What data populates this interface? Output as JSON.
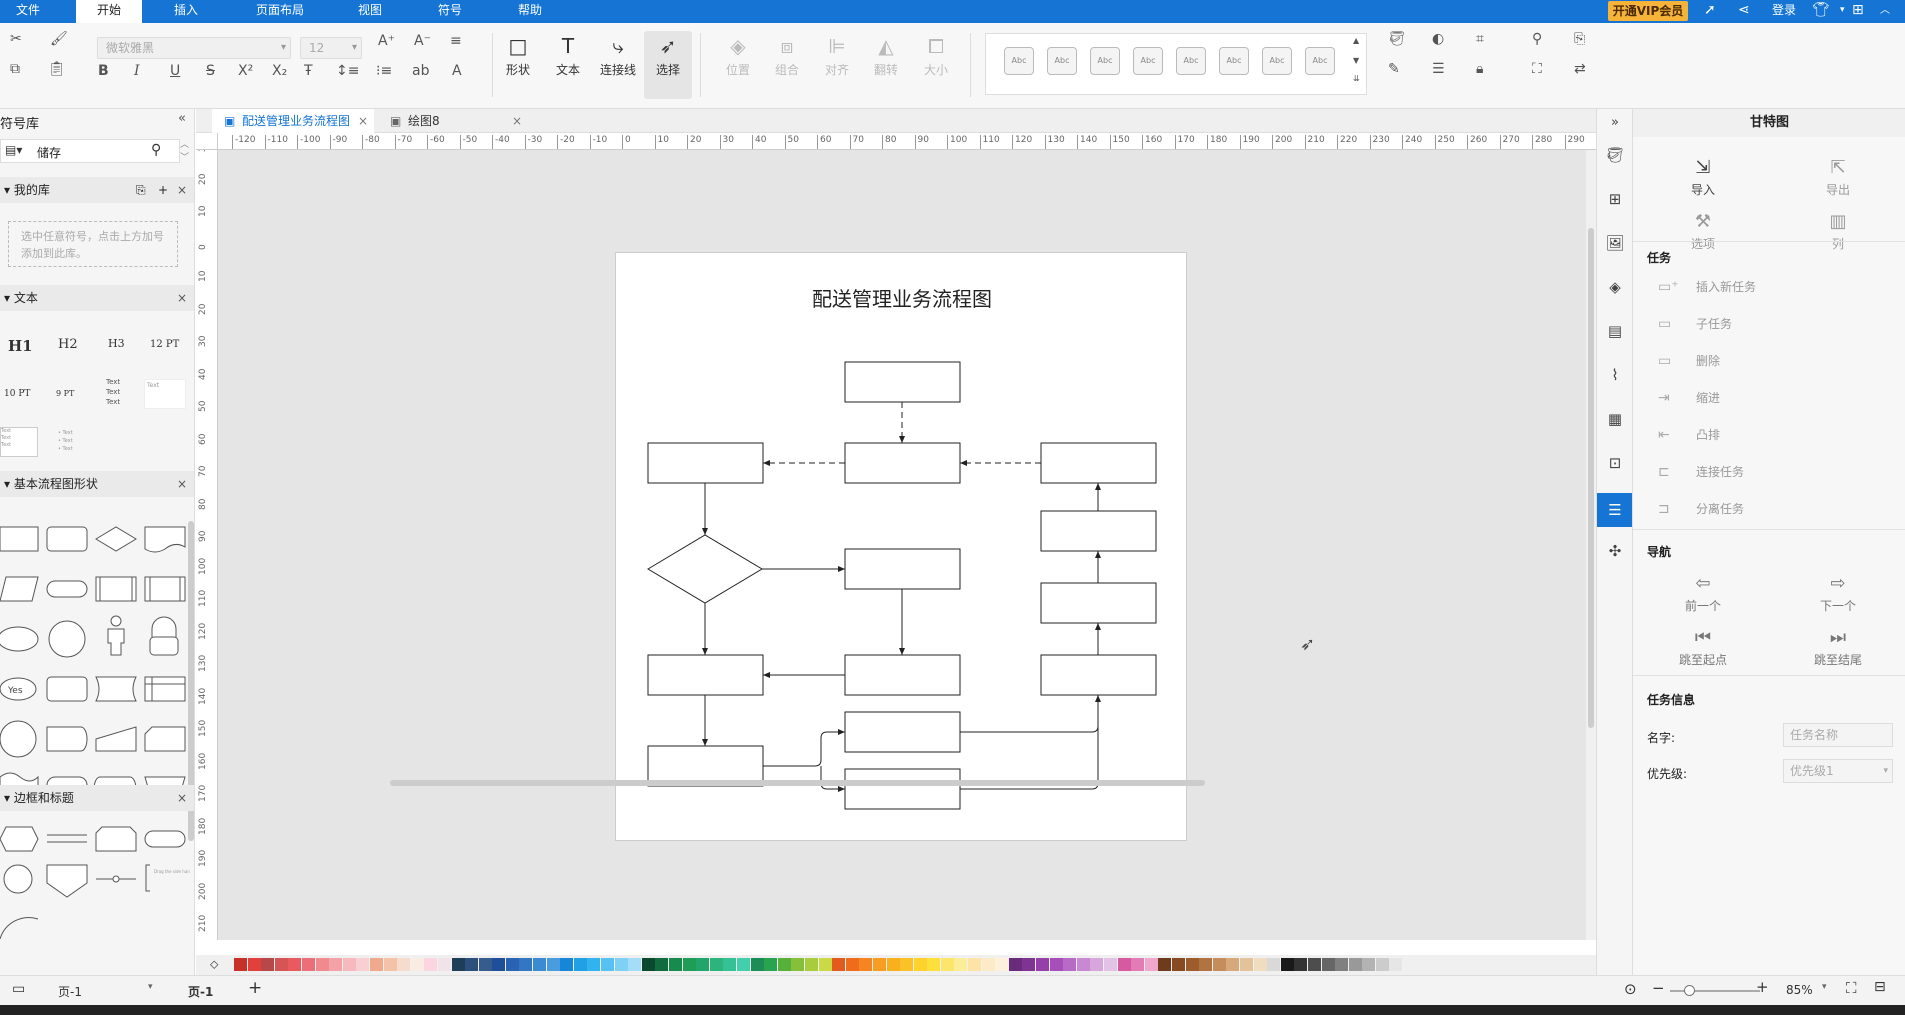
{
  "menu": {
    "items": [
      "文件",
      "开始",
      "插入",
      "页面布局",
      "视图",
      "符号",
      "帮助"
    ],
    "active": "开始",
    "vip": "开通VIP会员",
    "login": "登录"
  },
  "toolbar": {
    "font_family": "微软雅黑",
    "font_size": "12",
    "shape_label": "形状",
    "text_label": "文本",
    "connector_label": "连接线",
    "select_label": "选择",
    "position_label": "位置",
    "group_label": "组合",
    "align_label": "对齐",
    "flip_label": "翻转",
    "size_label": "大小",
    "style_sample": "Abc"
  },
  "left_panel": {
    "title": "符号库",
    "search_value": "储存",
    "my_library": "我的库",
    "my_library_hint": "选中任意符号，点击上方加号添加到此库。",
    "text_section": "文本",
    "text_items": [
      "H1",
      "H2",
      "H3",
      "12 PT",
      "10 PT",
      "9 PT"
    ],
    "flowchart_section": "基本流程图形状",
    "yes_label": "Yes",
    "frame_section": "边框和标题"
  },
  "tabs": [
    "配送管理业务流程图",
    "绘图8"
  ],
  "ruler": {
    "h_labels": [
      "-120",
      "-110",
      "-100",
      "-90",
      "-80",
      "-70",
      "-60",
      "-50",
      "-40",
      "-30",
      "-20",
      "-10",
      "0",
      "10",
      "20",
      "30",
      "40",
      "50",
      "60",
      "70",
      "80",
      "90",
      "100",
      "110",
      "120",
      "130",
      "140",
      "150",
      "160",
      "170",
      "180",
      "190",
      "200",
      "210",
      "220",
      "230",
      "240",
      "250",
      "260",
      "270",
      "280",
      "290"
    ],
    "v_labels": [
      "30",
      "20",
      "10",
      "0",
      "10",
      "20",
      "30",
      "40",
      "50",
      "60",
      "70",
      "80",
      "90",
      "100",
      "110",
      "120",
      "130",
      "140",
      "150",
      "160",
      "170",
      "180",
      "190",
      "200",
      "210"
    ]
  },
  "diagram": {
    "title": "配送管理业务流程图"
  },
  "palette": [
    "#c8302a",
    "#e1403b",
    "#b8474a",
    "#d55557",
    "#e9595f",
    "#eb6e79",
    "#f08a8e",
    "#f3a2a8",
    "#f6b9bd",
    "#f8cfd2",
    "#efa98d",
    "#f3c3a8",
    "#f6dccc",
    "#f9ece3",
    "#fbd6e1",
    "#f2e2ea",
    "#1e3d58",
    "#2d4f7c",
    "#355c8c",
    "#1f4e9b",
    "#2a63b1",
    "#3377c3",
    "#3c8ad2",
    "#4a9ce0",
    "#1686d9",
    "#21a0e5",
    "#31b3ef",
    "#57c2f2",
    "#7fd0f5",
    "#a5dcf7",
    "#0c4a2f",
    "#116b3f",
    "#178a4d",
    "#1f9c55",
    "#22a56a",
    "#2db47c",
    "#35c196",
    "#43ceac",
    "#1d8d57",
    "#28a34e",
    "#57b03a",
    "#86c03b",
    "#a9cc3e",
    "#c9da44",
    "#e25a1e",
    "#ee6c1c",
    "#f58520",
    "#f89d24",
    "#f9b01f",
    "#fbc227",
    "#fcd22d",
    "#fde03b",
    "#fbe66b",
    "#fcee98",
    "#fde3a6",
    "#fdeac6",
    "#fef1dc",
    "#6a2b7b",
    "#7f3392",
    "#953fa8",
    "#a64fb9",
    "#b86bc6",
    "#c989d2",
    "#d6a6dd",
    "#e2c3e7",
    "#d55aa0",
    "#e37bb5",
    "#f0a6cd",
    "#6e3b1d",
    "#874a22",
    "#9c5c2c",
    "#b07341",
    "#c48d5b",
    "#d7a97a",
    "#e5c39a",
    "#f0dcbf",
    "#d9d9d9",
    "#1a1a1a",
    "#333333",
    "#4d4d4d",
    "#666666",
    "#808080",
    "#999999",
    "#b3b3b3",
    "#cccccc",
    "#e6e6e6"
  ],
  "status": {
    "page_selector": "页-1",
    "page_tab": "页-1",
    "zoom": "85%"
  },
  "right_panel": {
    "title": "甘特图",
    "import": "导入",
    "export": "导出",
    "options": "选项",
    "columns": "列",
    "task_section": "任务",
    "task_items": [
      "插入新任务",
      "子任务",
      "删除",
      "缩进",
      "凸排",
      "连接任务",
      "分离任务"
    ],
    "nav_section": "导航",
    "prev": "前一个",
    "next": "下一个",
    "to_start": "跳至起点",
    "to_end": "跳至结尾",
    "info_section": "任务信息",
    "name_label": "名字:",
    "name_placeholder": "任务名称",
    "priority_label": "优先级:",
    "priority_value": "优先级1"
  }
}
